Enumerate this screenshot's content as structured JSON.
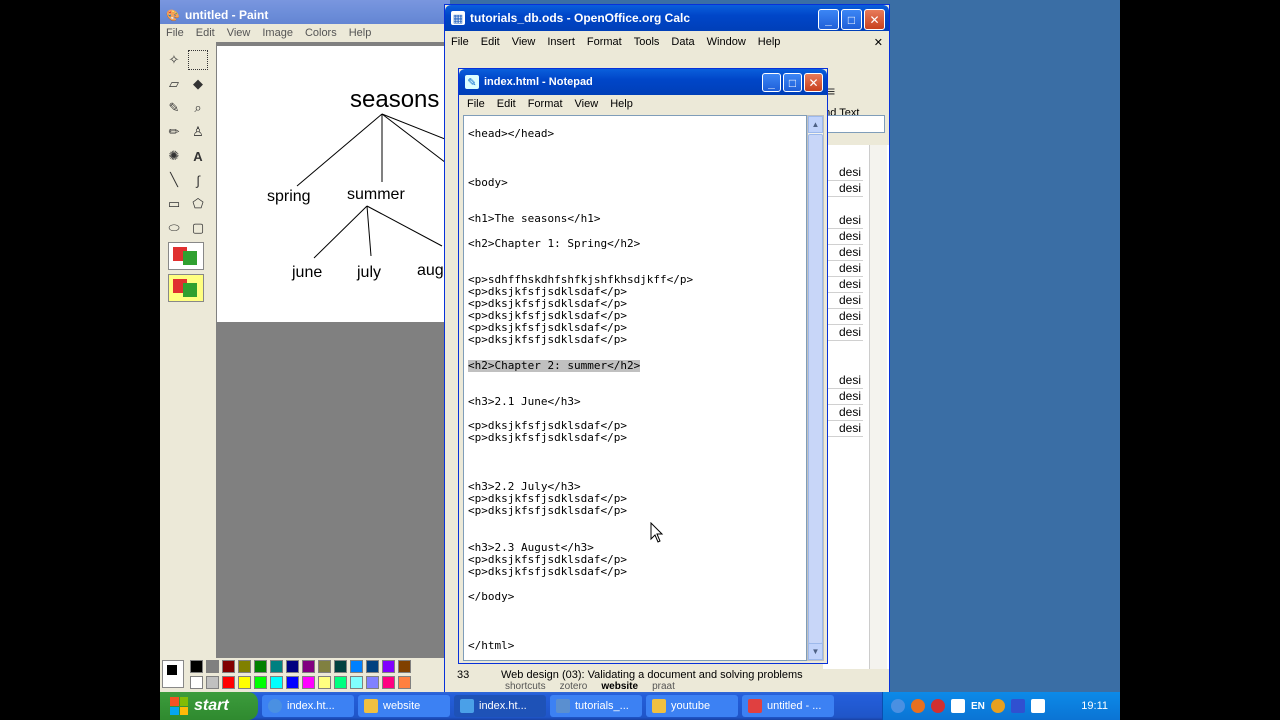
{
  "paint": {
    "title": "untitled - Paint",
    "menu": [
      "File",
      "Edit",
      "View",
      "Image",
      "Colors",
      "Help"
    ],
    "canvas_words": {
      "root": "seasons",
      "spring": "spring",
      "summer": "summer",
      "june": "june",
      "july": "july",
      "aug": "aug"
    }
  },
  "calc": {
    "title": "tutorials_db.ods - OpenOffice.org Calc",
    "menu": [
      "File",
      "Edit",
      "View",
      "Insert",
      "Format",
      "Tools",
      "Data",
      "Window",
      "Help"
    ],
    "find_text": "Find Text",
    "cell_values": [
      "desi",
      "desi",
      "desi",
      "desi",
      "desi",
      "desi",
      "desi",
      "desi",
      "desi",
      "desi",
      "desi",
      "desi",
      "desi",
      "desi"
    ],
    "status_row": "33",
    "status_text": "Web design (03): Validating a document and solving problems",
    "sheet_tabs": [
      "shortcuts",
      "zotero",
      "website",
      "praat"
    ]
  },
  "notepad": {
    "title": "index.html - Notepad",
    "menu": [
      "File",
      "Edit",
      "Format",
      "View",
      "Help"
    ],
    "lines": [
      "<head></head>",
      "<body>",
      "<h1>The seasons</h1>",
      "<h2>Chapter 1: Spring</h2>",
      "<p>sdhffhskdhfshfkjshfkhsdjkff</p>",
      "<p>dksjkfsfjsdklsdaf</p>",
      "<p>dksjkfsfjsdklsdaf</p>",
      "<p>dksjkfsfjsdklsdaf</p>",
      "<p>dksjkfsfjsdklsdaf</p>",
      "<p>dksjkfsfjsdklsdaf</p>",
      "<h2>Chapter 2: summer</h2>",
      "<h3>2.1 June</h3>",
      "<p>dksjkfsfjsdklsdaf</p>",
      "<p>dksjkfsfjsdklsdaf</p>",
      "<h3>2.2 July</h3>",
      "<p>dksjkfsfjsdklsdaf</p>",
      "<p>dksjkfsfjsdklsdaf</p>",
      "<h3>2.3 August</h3>",
      "<p>dksjkfsfjsdklsdaf</p>",
      "<p>dksjkfsfjsdklsdaf</p>",
      "</body>",
      "</html>"
    ]
  },
  "taskbar": {
    "start_label": "start",
    "tasks": [
      {
        "label": "index.ht...",
        "color": "#4a90e2"
      },
      {
        "label": "website",
        "color": "#f0c040"
      },
      {
        "label": "index.ht...",
        "color": "#4aa0e8"
      },
      {
        "label": "tutorials_...",
        "color": "#5a8fd0"
      },
      {
        "label": "youtube",
        "color": "#f0c040"
      },
      {
        "label": "untitled - ...",
        "color": "#e04040"
      }
    ],
    "language": "EN",
    "clock": "19:11"
  }
}
